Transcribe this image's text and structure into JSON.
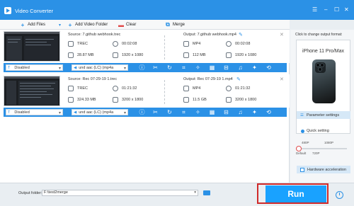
{
  "window": {
    "title": "Video Converter",
    "controls": {
      "menu": "☰",
      "minimize": "–",
      "maximize": "☐",
      "close": "✕"
    }
  },
  "toolbar": {
    "add_files": "Add Files",
    "add_video_folder": "Add Video Folder",
    "clear": "Clear",
    "merge": "Merge"
  },
  "files": [
    {
      "source": "Source: 7.github webhook.trec",
      "output": "Output: 7.github webhook.mp4",
      "src_format": "TREC",
      "src_duration": "00:02:08",
      "src_size": "28.87 MB",
      "src_resolution": "1920 x 1080",
      "out_format": "MP4",
      "out_duration": "00:02:08",
      "out_size": "112 MB",
      "out_resolution": "1920 x 1080",
      "subtitle": "Disabled",
      "audio": "und aac (LC) (mp4a"
    },
    {
      "source": "Source: Rec 07-29-19 1.trec",
      "output": "Output: Rec 07-29-19 1.mp4",
      "src_format": "TREC",
      "src_duration": "01:21:32",
      "src_size": "324.33 MB",
      "src_resolution": "3200 x 1800",
      "out_format": "MP4",
      "out_duration": "01:21:32",
      "out_size": "11.5 GB",
      "out_resolution": "3200 x 1800",
      "subtitle": "Disabled",
      "audio": "und aac (LC) (mp4a"
    }
  ],
  "right_panel": {
    "hint": "Click to change output format:",
    "device_name": "iPhone 11 Pro/Max",
    "parameter_settings": "Parameter settings",
    "quick_setting": "Quick setting",
    "scale_top": [
      "480P",
      "1080P"
    ],
    "scale_bottom": [
      "Default",
      "720P"
    ],
    "quality_level": 0.05,
    "hardware_acceleration": "Hardware acceleration"
  },
  "bottom": {
    "output_folder_label": "Output folder:",
    "output_folder_value": "F:\\test2merge",
    "run": "Run"
  },
  "colors": {
    "accent": "#2b91e6",
    "run_button": "#19a2ff",
    "highlight_border": "#d02a2a"
  }
}
